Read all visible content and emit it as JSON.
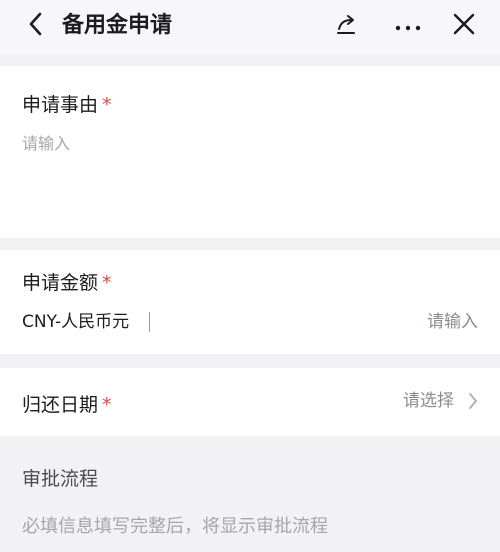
{
  "header": {
    "title": "备用金申请",
    "icons": [
      "chevron-left-icon",
      "share-icon",
      "more-icon",
      "close-icon"
    ]
  },
  "reason": {
    "label": "申请事由",
    "required_mark": "*",
    "placeholder": "请输入"
  },
  "amount": {
    "label": "申请金额",
    "required_mark": "*",
    "currency": "CNY-人民币元",
    "placeholder": "请输入"
  },
  "return_date": {
    "label": "归还日期",
    "required_mark": "*",
    "placeholder": "请选择"
  },
  "approval_flow": {
    "title": "审批流程",
    "note": "必填信息填写完整后，将显示审批流程"
  },
  "colors": {
    "required": "#e14b45",
    "placeholder": "#a4a6ab",
    "background": "#f2f2f4"
  }
}
